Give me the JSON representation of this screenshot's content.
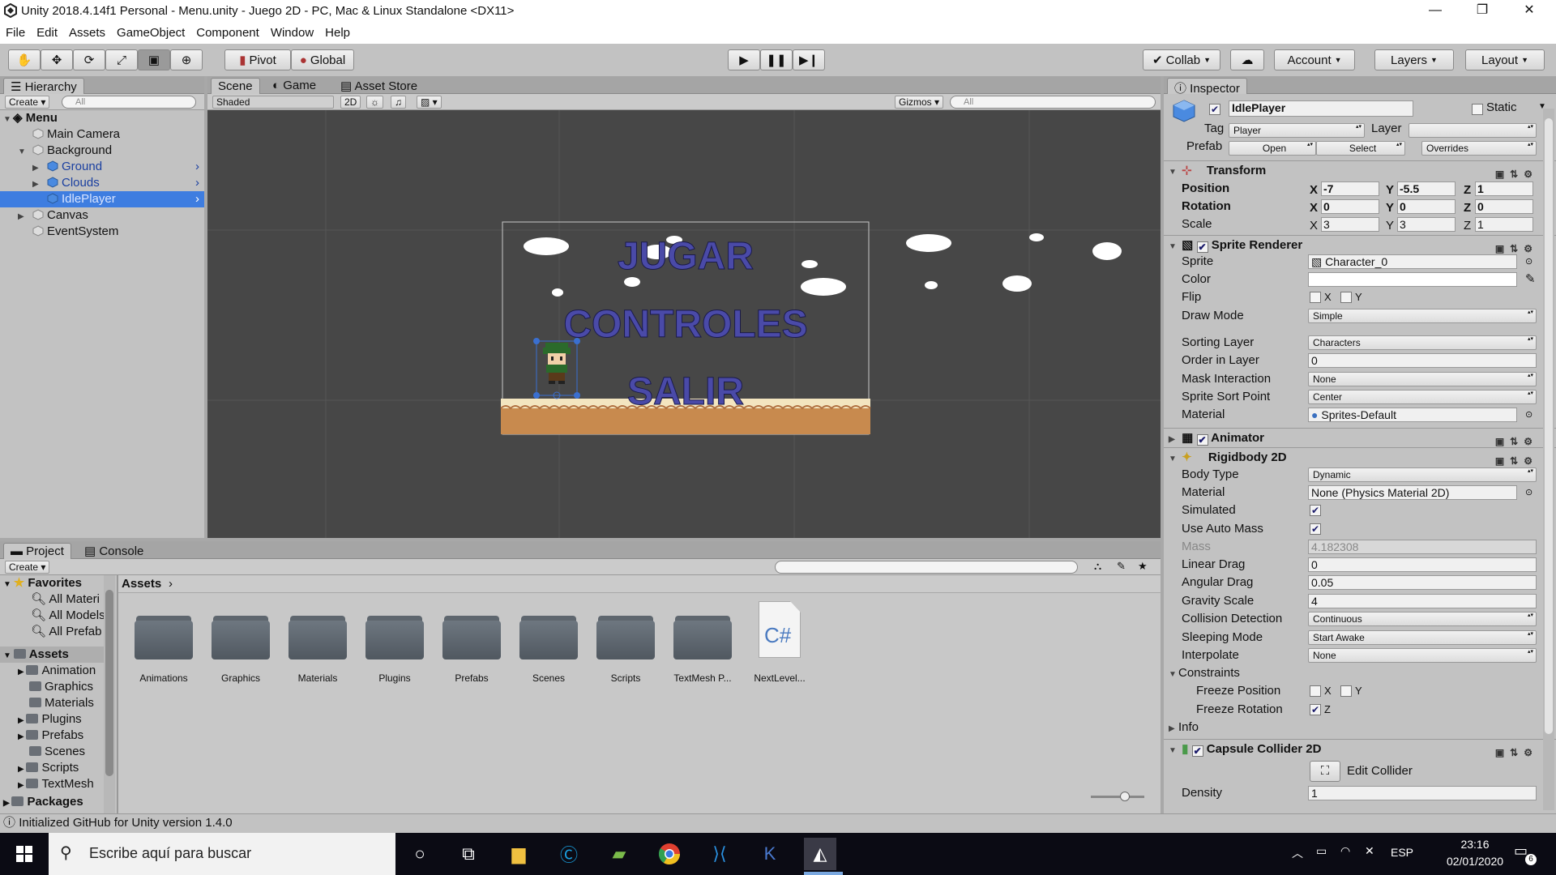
{
  "window": {
    "title": "Unity 2018.4.14f1 Personal - Menu.unity - Juego 2D - PC, Mac & Linux Standalone <DX11>",
    "minimize": "—",
    "maximize": "❐",
    "close": "✕"
  },
  "menu": [
    "File",
    "Edit",
    "Assets",
    "GameObject",
    "Component",
    "Window",
    "Help"
  ],
  "toolbar": {
    "tools": [
      "hand-icon",
      "move-icon",
      "rotate-icon",
      "scale-icon",
      "rect-icon",
      "transform-icon"
    ],
    "pivot": "Pivot",
    "global": "Global",
    "collab": "Collab",
    "account": "Account",
    "layers": "Layers",
    "layout": "Layout"
  },
  "hierarchy": {
    "tab": "Hierarchy",
    "create": "Create",
    "search_placeholder": "All",
    "scene": "Menu",
    "items": [
      "Main Camera",
      "Background",
      "Ground",
      "Clouds",
      "IdlePlayer",
      "Canvas",
      "EventSystem"
    ]
  },
  "scene_view": {
    "tabs": [
      "Scene",
      "Game",
      "Asset Store"
    ],
    "shading": "Shaded",
    "mode2d": "2D",
    "gizmos": "Gizmos",
    "search_placeholder": "All",
    "buttons": [
      "JUGAR",
      "CONTROLES",
      "SALIR"
    ]
  },
  "inspector": {
    "tab": "Inspector",
    "object_name": "IdlePlayer",
    "static_label": "Static",
    "tag_label": "Tag",
    "tag_value": "Player",
    "layer_label": "Layer",
    "prefab_label": "Prefab",
    "prefab_open": "Open",
    "prefab_select": "Select",
    "prefab_overrides": "Overrides",
    "transform": {
      "title": "Transform",
      "position_label": "Position",
      "rotation_label": "Rotation",
      "scale_label": "Scale",
      "position": [
        "-7",
        "-5.5",
        "1"
      ],
      "rotation": [
        "0",
        "0",
        "0"
      ],
      "scale": [
        "3",
        "3",
        "1"
      ]
    },
    "sprite_renderer": {
      "title": "Sprite Renderer",
      "sprite_label": "Sprite",
      "sprite": "Character_0",
      "color_label": "Color",
      "flip_label": "Flip",
      "draw_mode_label": "Draw Mode",
      "draw_mode": "Simple",
      "sorting_layer_label": "Sorting Layer",
      "sorting_layer": "Characters",
      "order_label": "Order in Layer",
      "order": "0",
      "mask_label": "Mask Interaction",
      "mask": "None",
      "sort_point_label": "Sprite Sort Point",
      "sort_point": "Center",
      "material_label": "Material",
      "material": "Sprites-Default"
    },
    "animator": {
      "title": "Animator"
    },
    "rigidbody": {
      "title": "Rigidbody 2D",
      "body_type_label": "Body Type",
      "body_type": "Dynamic",
      "material_label": "Material",
      "material": "None (Physics Material 2D)",
      "simulated_label": "Simulated",
      "auto_mass_label": "Use Auto Mass",
      "mass_label": "Mass",
      "mass": "4.182308",
      "linear_drag_label": "Linear Drag",
      "linear_drag": "0",
      "angular_drag_label": "Angular Drag",
      "angular_drag": "0.05",
      "gravity_label": "Gravity Scale",
      "gravity": "4",
      "collision_label": "Collision Detection",
      "collision": "Continuous",
      "sleeping_label": "Sleeping Mode",
      "sleeping": "Start Awake",
      "interpolate_label": "Interpolate",
      "interpolate": "None",
      "constraints_label": "Constraints",
      "freeze_pos_label": "Freeze Position",
      "freeze_rot_label": "Freeze Rotation",
      "info_label": "Info"
    },
    "capsule": {
      "title": "Capsule Collider 2D",
      "edit_collider": "Edit Collider",
      "density_label": "Density",
      "density": "1"
    }
  },
  "project": {
    "tabs": [
      "Project",
      "Console"
    ],
    "create": "Create",
    "favorites": "Favorites",
    "fav_items": [
      "All Materi",
      "All Models",
      "All Prefab"
    ],
    "assets_label": "Assets",
    "tree": [
      "Animation",
      "Graphics",
      "Materials",
      "Plugins",
      "Prefabs",
      "Scenes",
      "Scripts",
      "TextMesh"
    ],
    "packages": "Packages",
    "breadcrumb": "Assets",
    "folders": [
      "Animations",
      "Graphics",
      "Materials",
      "Plugins",
      "Prefabs",
      "Scenes",
      "Scripts",
      "TextMesh P..."
    ],
    "script_file": "NextLevel...",
    "script_icon": "C#"
  },
  "status": "Initialized GitHub for Unity version 1.4.0",
  "taskbar": {
    "search_placeholder": "Escribe aquí para buscar",
    "lang": "ESP",
    "time": "23:16",
    "date": "02/01/2020",
    "notif_count": "6"
  }
}
